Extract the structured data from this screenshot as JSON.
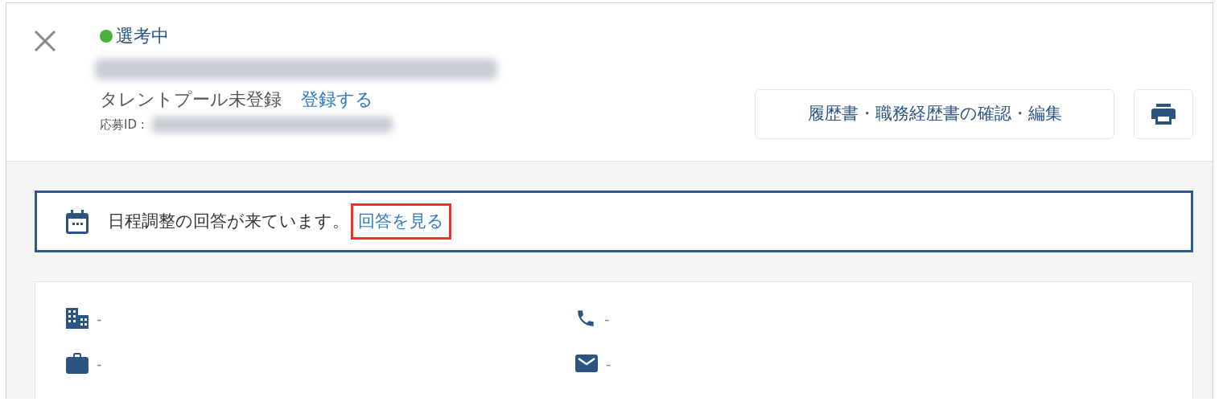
{
  "header": {
    "status": {
      "label": "選考中",
      "color": "#4cae3c"
    },
    "talent_pool": {
      "label": "タレントプール未登録",
      "link": "登録する"
    },
    "application_id_label": "応募ID :",
    "resume_button": "履歴書・職務経歴書の確認・編集"
  },
  "notice": {
    "message": "日程調整の回答が来ています。",
    "link": "回答を見る",
    "highlighted": true
  },
  "info": [
    {
      "kind": "company",
      "value": "-"
    },
    {
      "kind": "phone",
      "value": "-"
    },
    {
      "kind": "job",
      "value": "-"
    },
    {
      "kind": "email",
      "value": "-"
    }
  ]
}
